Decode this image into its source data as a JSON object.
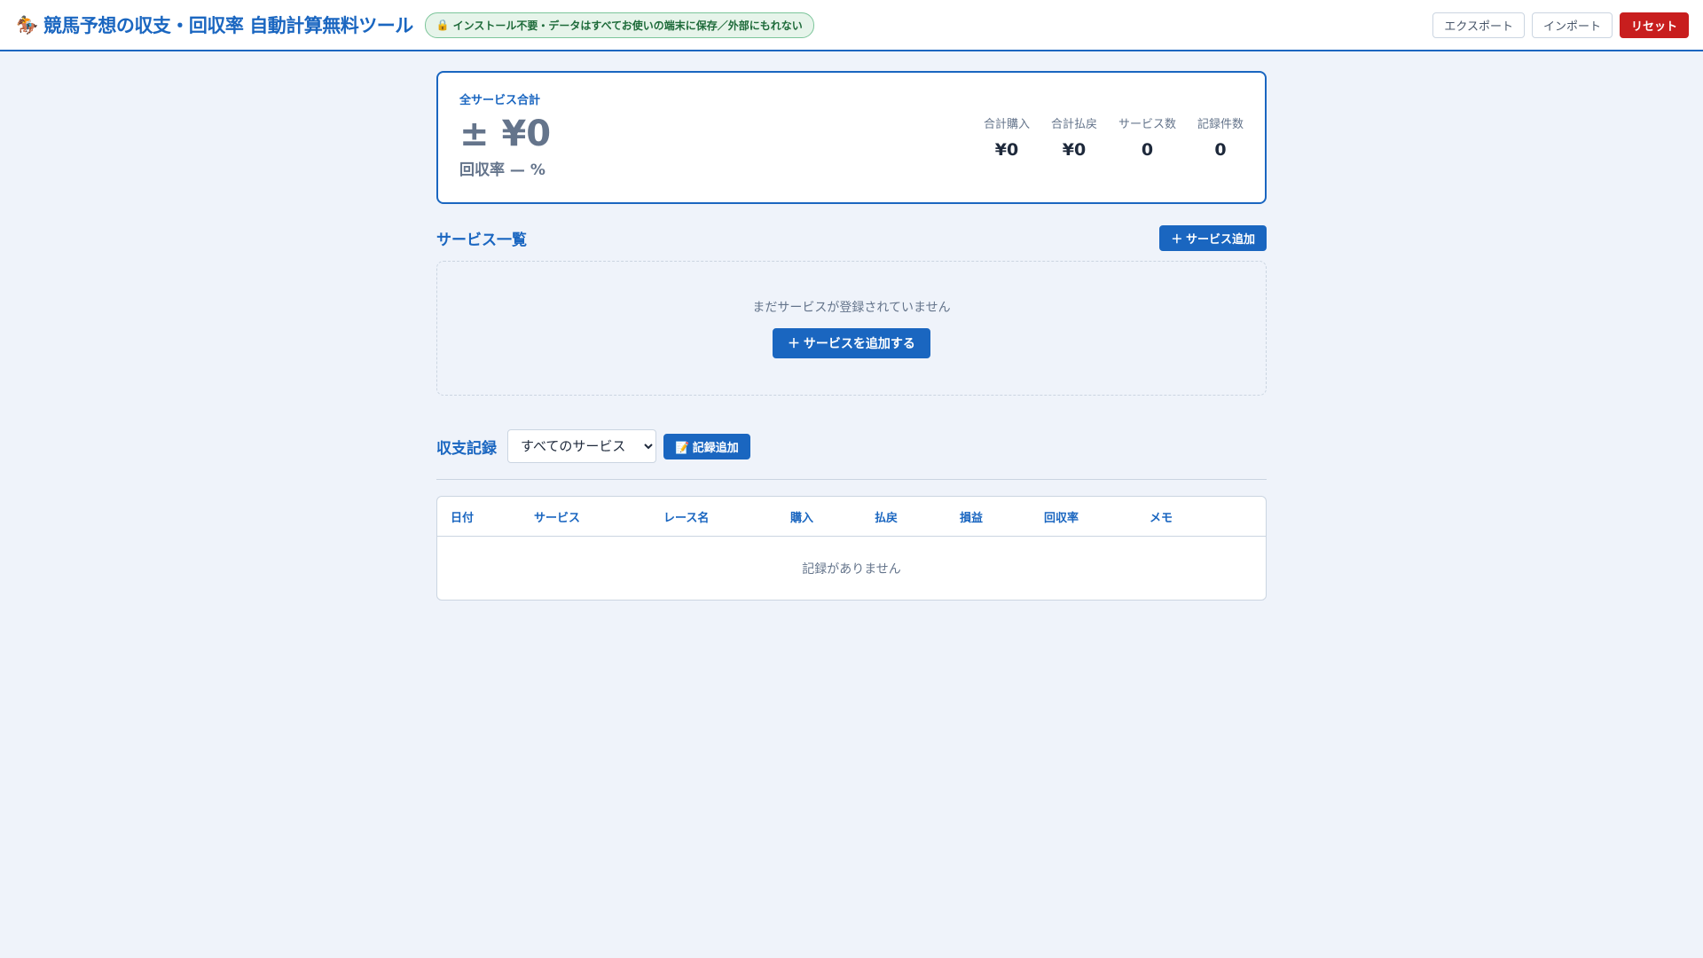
{
  "header": {
    "logo_icon": "horse-racing-icon",
    "title": "競馬予想の収支・回収率 自動計算無料ツール",
    "badge_icon": "lock-icon",
    "badge": "インストール不要・データはすべてお使いの端末に保存／外部にもれない",
    "export": "エクスポート",
    "import": "インポート",
    "reset": "リセット"
  },
  "summary": {
    "label": "全サービス合計",
    "total": "± ¥0",
    "rate": "回収率 — %",
    "stats": [
      {
        "label": "合計購入",
        "value": "¥0"
      },
      {
        "label": "合計払戻",
        "value": "¥0"
      },
      {
        "label": "サービス数",
        "value": "0"
      },
      {
        "label": "記録件数",
        "value": "0"
      }
    ]
  },
  "services": {
    "heading": "サービス一覧",
    "add": "＋ サービス追加",
    "empty": "まだサービスが登録されていません",
    "add_big": "＋ サービスを追加する"
  },
  "records": {
    "heading": "収支記録",
    "filter": "すべてのサービス",
    "add": "📝 記録追加",
    "columns": [
      "日付",
      "サービス",
      "レース名",
      "購入",
      "払戻",
      "損益",
      "回収率",
      "メモ"
    ],
    "empty": "記録がありません"
  },
  "colors": {
    "accent": "#1a66c0",
    "danger": "#c81e1e"
  }
}
